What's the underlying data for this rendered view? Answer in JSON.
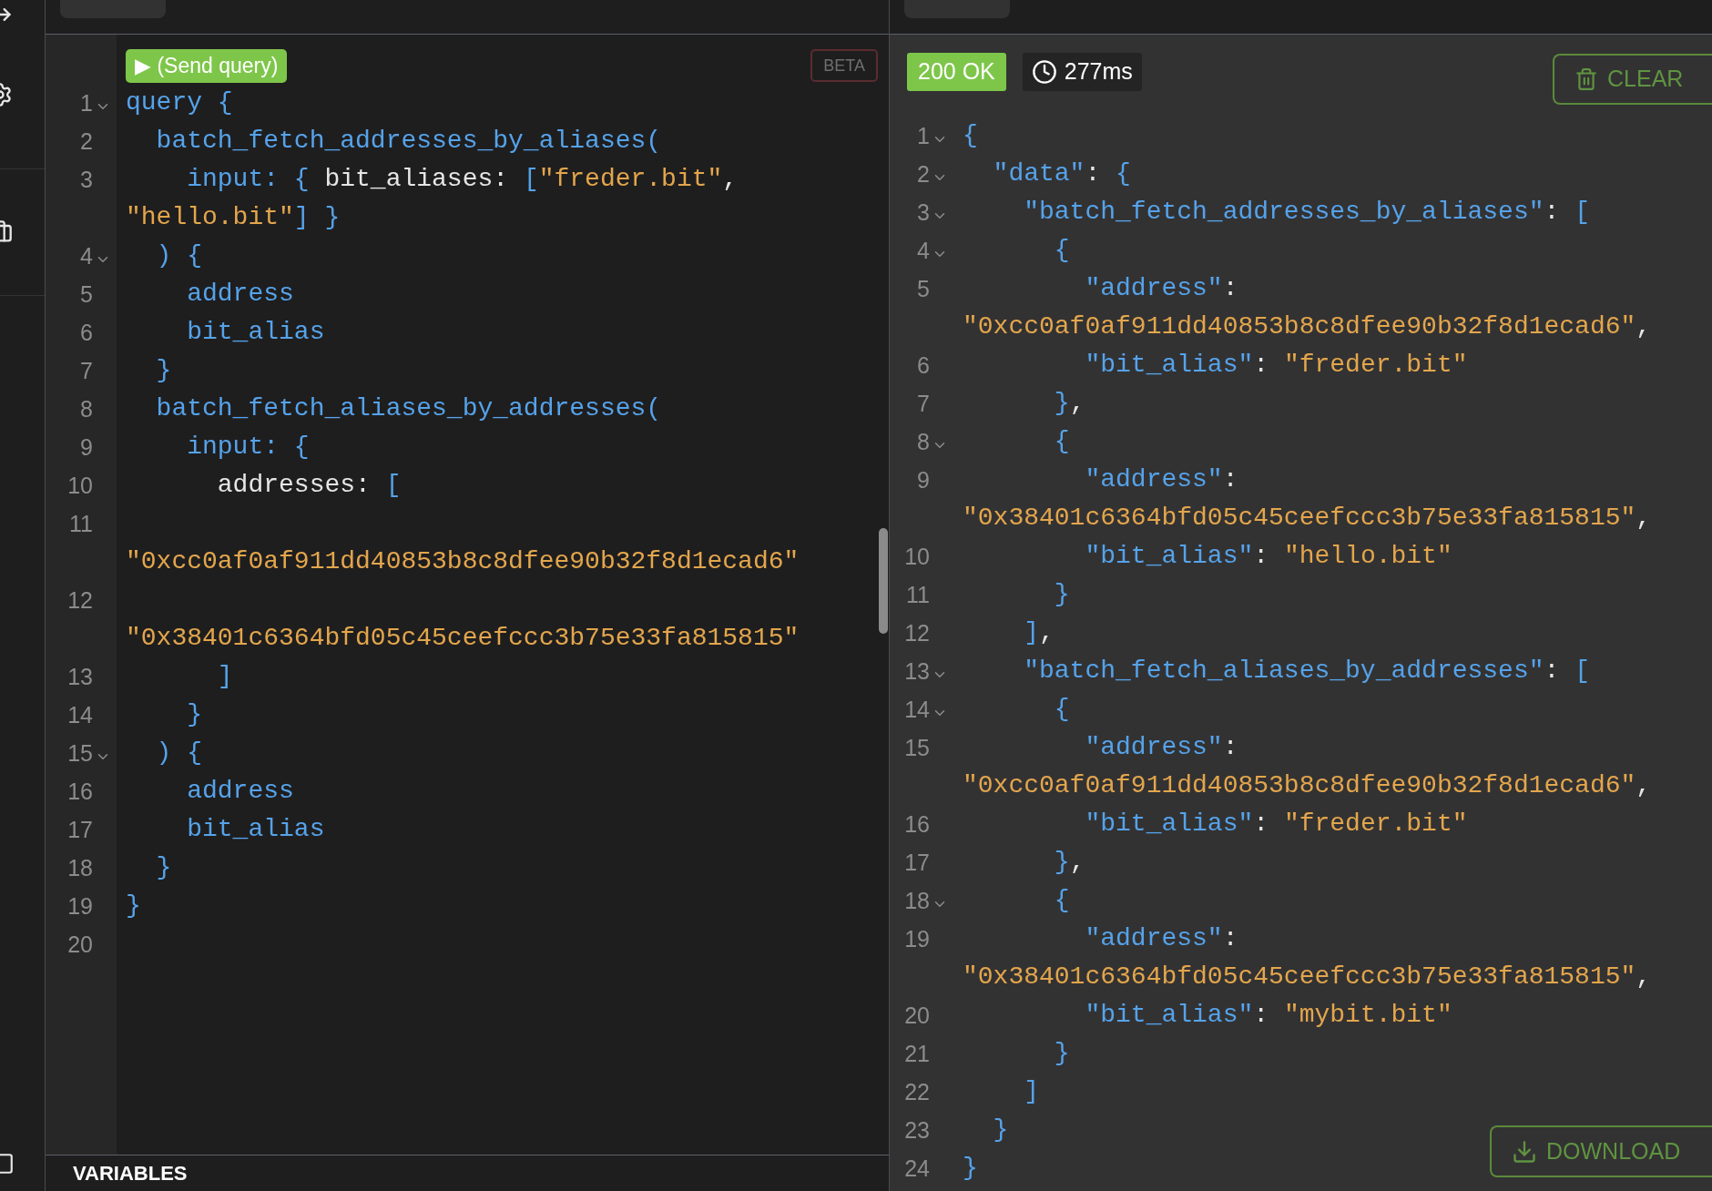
{
  "query_panel": {
    "send_button": "▶ (Send query)",
    "badge": "BETA",
    "lines": [
      {
        "number": "1",
        "fold": true,
        "tokens": [
          {
            "kind": "keyword",
            "text": "query {"
          }
        ]
      },
      {
        "number": "2",
        "fold": false,
        "tokens": [
          {
            "kind": "keyword",
            "text": "  batch_fetch_addresses_by_aliases("
          }
        ]
      },
      {
        "number": "3",
        "fold": false,
        "tokens": [
          {
            "kind": "keyword",
            "text": "    input: { "
          },
          {
            "kind": "plain",
            "text": "bit_aliases: "
          },
          {
            "kind": "keyword",
            "text": "["
          },
          {
            "kind": "string",
            "text": "\"freder.bit\""
          },
          {
            "kind": "plain",
            "text": ","
          },
          {
            "kind": "break"
          },
          {
            "kind": "string",
            "text": "\"hello.bit\""
          },
          {
            "kind": "keyword",
            "text": "] }"
          }
        ]
      },
      {
        "number": "4",
        "fold": true,
        "tokens": [
          {
            "kind": "keyword",
            "text": "  ) {"
          }
        ]
      },
      {
        "number": "5",
        "fold": false,
        "tokens": [
          {
            "kind": "keyword",
            "text": "    address"
          }
        ]
      },
      {
        "number": "6",
        "fold": false,
        "tokens": [
          {
            "kind": "keyword",
            "text": "    bit_alias"
          }
        ]
      },
      {
        "number": "7",
        "fold": false,
        "tokens": [
          {
            "kind": "keyword",
            "text": "  }"
          }
        ]
      },
      {
        "number": "8",
        "fold": false,
        "tokens": [
          {
            "kind": "keyword",
            "text": "  batch_fetch_aliases_by_addresses("
          }
        ]
      },
      {
        "number": "9",
        "fold": false,
        "tokens": [
          {
            "kind": "keyword",
            "text": "    input: {"
          }
        ]
      },
      {
        "number": "10",
        "fold": false,
        "tokens": [
          {
            "kind": "plain",
            "text": "      addresses: "
          },
          {
            "kind": "keyword",
            "text": "["
          }
        ]
      },
      {
        "number": "11",
        "fold": false,
        "tokens": [
          {
            "kind": "break"
          },
          {
            "kind": "string",
            "text": "\"0xcc0af0af911dd40853b8c8dfee90b32f8d1ecad6\""
          }
        ]
      },
      {
        "number": "12",
        "fold": false,
        "tokens": [
          {
            "kind": "break"
          },
          {
            "kind": "string",
            "text": "\"0x38401c6364bfd05c45ceefccc3b75e33fa815815\""
          }
        ]
      },
      {
        "number": "13",
        "fold": false,
        "tokens": [
          {
            "kind": "keyword",
            "text": "      ]"
          }
        ]
      },
      {
        "number": "14",
        "fold": false,
        "tokens": [
          {
            "kind": "keyword",
            "text": "    }"
          }
        ]
      },
      {
        "number": "15",
        "fold": true,
        "tokens": [
          {
            "kind": "keyword",
            "text": "  ) {"
          }
        ]
      },
      {
        "number": "16",
        "fold": false,
        "tokens": [
          {
            "kind": "keyword",
            "text": "    address"
          }
        ]
      },
      {
        "number": "17",
        "fold": false,
        "tokens": [
          {
            "kind": "keyword",
            "text": "    bit_alias"
          }
        ]
      },
      {
        "number": "18",
        "fold": false,
        "tokens": [
          {
            "kind": "keyword",
            "text": "  }"
          }
        ]
      },
      {
        "number": "19",
        "fold": false,
        "tokens": [
          {
            "kind": "keyword",
            "text": "}"
          }
        ]
      },
      {
        "number": "20",
        "fold": false
      }
    ],
    "variables_header": "VARIABLES"
  },
  "response_panel": {
    "status": "200 OK",
    "time": "277ms",
    "clear_button": "CLEAR",
    "download_button": "DOWNLOAD",
    "lines": [
      {
        "number": "1",
        "fold": true,
        "tokens": [
          {
            "kind": "keyword",
            "text": "{"
          }
        ]
      },
      {
        "number": "2",
        "fold": true,
        "tokens": [
          {
            "kind": "keyword",
            "text": "  \"data\""
          },
          {
            "kind": "plain",
            "text": ": "
          },
          {
            "kind": "keyword",
            "text": "{"
          }
        ]
      },
      {
        "number": "3",
        "fold": true,
        "tokens": [
          {
            "kind": "keyword",
            "text": "    \"batch_fetch_addresses_by_aliases\""
          },
          {
            "kind": "plain",
            "text": ": "
          },
          {
            "kind": "keyword",
            "text": "["
          }
        ]
      },
      {
        "number": "4",
        "fold": true,
        "tokens": [
          {
            "kind": "keyword",
            "text": "      {"
          }
        ]
      },
      {
        "number": "5",
        "fold": false,
        "tokens": [
          {
            "kind": "keyword",
            "text": "        \"address\""
          },
          {
            "kind": "plain",
            "text": ":"
          },
          {
            "kind": "break"
          },
          {
            "kind": "string",
            "text": "\"0xcc0af0af911dd40853b8c8dfee90b32f8d1ecad6\""
          },
          {
            "kind": "plain",
            "text": ","
          }
        ]
      },
      {
        "number": "6",
        "fold": false,
        "tokens": [
          {
            "kind": "keyword",
            "text": "        \"bit_alias\""
          },
          {
            "kind": "plain",
            "text": ": "
          },
          {
            "kind": "string",
            "text": "\"freder.bit\""
          }
        ]
      },
      {
        "number": "7",
        "fold": false,
        "tokens": [
          {
            "kind": "keyword",
            "text": "      }"
          },
          {
            "kind": "plain",
            "text": ","
          }
        ]
      },
      {
        "number": "8",
        "fold": true,
        "tokens": [
          {
            "kind": "keyword",
            "text": "      {"
          }
        ]
      },
      {
        "number": "9",
        "fold": false,
        "tokens": [
          {
            "kind": "keyword",
            "text": "        \"address\""
          },
          {
            "kind": "plain",
            "text": ":"
          },
          {
            "kind": "break"
          },
          {
            "kind": "string",
            "text": "\"0x38401c6364bfd05c45ceefccc3b75e33fa815815\""
          },
          {
            "kind": "plain",
            "text": ","
          }
        ]
      },
      {
        "number": "10",
        "fold": false,
        "tokens": [
          {
            "kind": "keyword",
            "text": "        \"bit_alias\""
          },
          {
            "kind": "plain",
            "text": ": "
          },
          {
            "kind": "string",
            "text": "\"hello.bit\""
          }
        ]
      },
      {
        "number": "11",
        "fold": false,
        "tokens": [
          {
            "kind": "keyword",
            "text": "      }"
          }
        ]
      },
      {
        "number": "12",
        "fold": false,
        "tokens": [
          {
            "kind": "keyword",
            "text": "    ]"
          },
          {
            "kind": "plain",
            "text": ","
          }
        ]
      },
      {
        "number": "13",
        "fold": true,
        "tokens": [
          {
            "kind": "keyword",
            "text": "    \"batch_fetch_aliases_by_addresses\""
          },
          {
            "kind": "plain",
            "text": ": "
          },
          {
            "kind": "keyword",
            "text": "["
          }
        ]
      },
      {
        "number": "14",
        "fold": true,
        "tokens": [
          {
            "kind": "keyword",
            "text": "      {"
          }
        ]
      },
      {
        "number": "15",
        "fold": false,
        "tokens": [
          {
            "kind": "keyword",
            "text": "        \"address\""
          },
          {
            "kind": "plain",
            "text": ":"
          },
          {
            "kind": "break"
          },
          {
            "kind": "string",
            "text": "\"0xcc0af0af911dd40853b8c8dfee90b32f8d1ecad6\""
          },
          {
            "kind": "plain",
            "text": ","
          }
        ]
      },
      {
        "number": "16",
        "fold": false,
        "tokens": [
          {
            "kind": "keyword",
            "text": "        \"bit_alias\""
          },
          {
            "kind": "plain",
            "text": ": "
          },
          {
            "kind": "string",
            "text": "\"freder.bit\""
          }
        ]
      },
      {
        "number": "17",
        "fold": false,
        "tokens": [
          {
            "kind": "keyword",
            "text": "      }"
          },
          {
            "kind": "plain",
            "text": ","
          }
        ]
      },
      {
        "number": "18",
        "fold": true,
        "tokens": [
          {
            "kind": "keyword",
            "text": "      {"
          }
        ]
      },
      {
        "number": "19",
        "fold": false,
        "tokens": [
          {
            "kind": "keyword",
            "text": "        \"address\""
          },
          {
            "kind": "plain",
            "text": ":"
          },
          {
            "kind": "break"
          },
          {
            "kind": "string",
            "text": "\"0x38401c6364bfd05c45ceefccc3b75e33fa815815\""
          },
          {
            "kind": "plain",
            "text": ","
          }
        ]
      },
      {
        "number": "20",
        "fold": false,
        "tokens": [
          {
            "kind": "keyword",
            "text": "        \"bit_alias\""
          },
          {
            "kind": "plain",
            "text": ": "
          },
          {
            "kind": "string",
            "text": "\"mybit.bit\""
          }
        ]
      },
      {
        "number": "21",
        "fold": false,
        "tokens": [
          {
            "kind": "keyword",
            "text": "      }"
          }
        ]
      },
      {
        "number": "22",
        "fold": false,
        "tokens": [
          {
            "kind": "keyword",
            "text": "    ]"
          }
        ]
      },
      {
        "number": "23",
        "fold": false,
        "tokens": [
          {
            "kind": "keyword",
            "text": "  }"
          }
        ]
      },
      {
        "number": "24",
        "fold": false,
        "tokens": [
          {
            "kind": "keyword",
            "text": "}"
          }
        ]
      }
    ]
  }
}
